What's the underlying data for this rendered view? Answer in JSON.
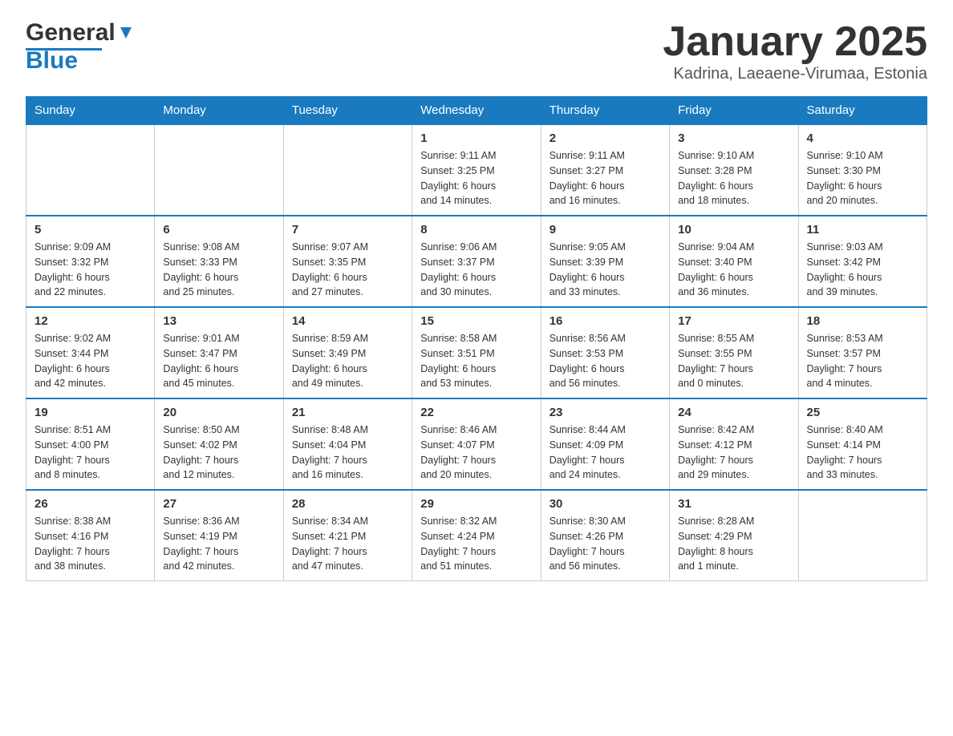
{
  "header": {
    "logo_general": "General",
    "logo_blue": "Blue",
    "title": "January 2025",
    "subtitle": "Kadrina, Laeaene-Virumaa, Estonia"
  },
  "days_of_week": [
    "Sunday",
    "Monday",
    "Tuesday",
    "Wednesday",
    "Thursday",
    "Friday",
    "Saturday"
  ],
  "weeks": [
    [
      {
        "num": "",
        "info": ""
      },
      {
        "num": "",
        "info": ""
      },
      {
        "num": "",
        "info": ""
      },
      {
        "num": "1",
        "info": "Sunrise: 9:11 AM\nSunset: 3:25 PM\nDaylight: 6 hours\nand 14 minutes."
      },
      {
        "num": "2",
        "info": "Sunrise: 9:11 AM\nSunset: 3:27 PM\nDaylight: 6 hours\nand 16 minutes."
      },
      {
        "num": "3",
        "info": "Sunrise: 9:10 AM\nSunset: 3:28 PM\nDaylight: 6 hours\nand 18 minutes."
      },
      {
        "num": "4",
        "info": "Sunrise: 9:10 AM\nSunset: 3:30 PM\nDaylight: 6 hours\nand 20 minutes."
      }
    ],
    [
      {
        "num": "5",
        "info": "Sunrise: 9:09 AM\nSunset: 3:32 PM\nDaylight: 6 hours\nand 22 minutes."
      },
      {
        "num": "6",
        "info": "Sunrise: 9:08 AM\nSunset: 3:33 PM\nDaylight: 6 hours\nand 25 minutes."
      },
      {
        "num": "7",
        "info": "Sunrise: 9:07 AM\nSunset: 3:35 PM\nDaylight: 6 hours\nand 27 minutes."
      },
      {
        "num": "8",
        "info": "Sunrise: 9:06 AM\nSunset: 3:37 PM\nDaylight: 6 hours\nand 30 minutes."
      },
      {
        "num": "9",
        "info": "Sunrise: 9:05 AM\nSunset: 3:39 PM\nDaylight: 6 hours\nand 33 minutes."
      },
      {
        "num": "10",
        "info": "Sunrise: 9:04 AM\nSunset: 3:40 PM\nDaylight: 6 hours\nand 36 minutes."
      },
      {
        "num": "11",
        "info": "Sunrise: 9:03 AM\nSunset: 3:42 PM\nDaylight: 6 hours\nand 39 minutes."
      }
    ],
    [
      {
        "num": "12",
        "info": "Sunrise: 9:02 AM\nSunset: 3:44 PM\nDaylight: 6 hours\nand 42 minutes."
      },
      {
        "num": "13",
        "info": "Sunrise: 9:01 AM\nSunset: 3:47 PM\nDaylight: 6 hours\nand 45 minutes."
      },
      {
        "num": "14",
        "info": "Sunrise: 8:59 AM\nSunset: 3:49 PM\nDaylight: 6 hours\nand 49 minutes."
      },
      {
        "num": "15",
        "info": "Sunrise: 8:58 AM\nSunset: 3:51 PM\nDaylight: 6 hours\nand 53 minutes."
      },
      {
        "num": "16",
        "info": "Sunrise: 8:56 AM\nSunset: 3:53 PM\nDaylight: 6 hours\nand 56 minutes."
      },
      {
        "num": "17",
        "info": "Sunrise: 8:55 AM\nSunset: 3:55 PM\nDaylight: 7 hours\nand 0 minutes."
      },
      {
        "num": "18",
        "info": "Sunrise: 8:53 AM\nSunset: 3:57 PM\nDaylight: 7 hours\nand 4 minutes."
      }
    ],
    [
      {
        "num": "19",
        "info": "Sunrise: 8:51 AM\nSunset: 4:00 PM\nDaylight: 7 hours\nand 8 minutes."
      },
      {
        "num": "20",
        "info": "Sunrise: 8:50 AM\nSunset: 4:02 PM\nDaylight: 7 hours\nand 12 minutes."
      },
      {
        "num": "21",
        "info": "Sunrise: 8:48 AM\nSunset: 4:04 PM\nDaylight: 7 hours\nand 16 minutes."
      },
      {
        "num": "22",
        "info": "Sunrise: 8:46 AM\nSunset: 4:07 PM\nDaylight: 7 hours\nand 20 minutes."
      },
      {
        "num": "23",
        "info": "Sunrise: 8:44 AM\nSunset: 4:09 PM\nDaylight: 7 hours\nand 24 minutes."
      },
      {
        "num": "24",
        "info": "Sunrise: 8:42 AM\nSunset: 4:12 PM\nDaylight: 7 hours\nand 29 minutes."
      },
      {
        "num": "25",
        "info": "Sunrise: 8:40 AM\nSunset: 4:14 PM\nDaylight: 7 hours\nand 33 minutes."
      }
    ],
    [
      {
        "num": "26",
        "info": "Sunrise: 8:38 AM\nSunset: 4:16 PM\nDaylight: 7 hours\nand 38 minutes."
      },
      {
        "num": "27",
        "info": "Sunrise: 8:36 AM\nSunset: 4:19 PM\nDaylight: 7 hours\nand 42 minutes."
      },
      {
        "num": "28",
        "info": "Sunrise: 8:34 AM\nSunset: 4:21 PM\nDaylight: 7 hours\nand 47 minutes."
      },
      {
        "num": "29",
        "info": "Sunrise: 8:32 AM\nSunset: 4:24 PM\nDaylight: 7 hours\nand 51 minutes."
      },
      {
        "num": "30",
        "info": "Sunrise: 8:30 AM\nSunset: 4:26 PM\nDaylight: 7 hours\nand 56 minutes."
      },
      {
        "num": "31",
        "info": "Sunrise: 8:28 AM\nSunset: 4:29 PM\nDaylight: 8 hours\nand 1 minute."
      },
      {
        "num": "",
        "info": ""
      }
    ]
  ]
}
